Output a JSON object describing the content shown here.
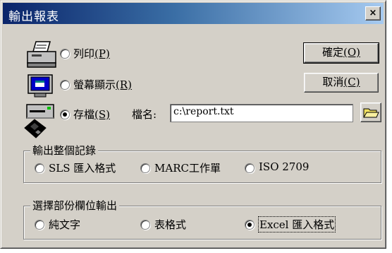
{
  "window": {
    "title": "輸出報表",
    "close_glyph": "×"
  },
  "output_target": {
    "print_label": "列印",
    "print_key": "(P)",
    "screen_label": "螢幕顯示",
    "screen_key": "(R)",
    "save_label": "存檔",
    "save_key": "(S)",
    "selected": "save"
  },
  "file": {
    "name_label": "檔名:",
    "value": "c:\\report.txt"
  },
  "buttons": {
    "ok_label": "確定",
    "ok_key": "(O)",
    "cancel_label": "取消",
    "cancel_key": "(C)"
  },
  "whole_record": {
    "title": "輸出整個記錄",
    "options": [
      "SLS 匯入格式",
      "MARC工作單",
      "ISO 2709"
    ]
  },
  "partial_fields": {
    "title": "選擇部份欄位輸出",
    "options": [
      "純文字",
      "表格式",
      "Excel 匯入格式"
    ],
    "selected_index": 2
  },
  "icons": [
    "printer-icon",
    "monitor-icon",
    "disk-drive-icon",
    "floppy-icon",
    "folder-icon"
  ],
  "colors": {
    "title_bar_start": "#0a246a",
    "title_bar_end": "#a6caf0",
    "face": "#d4d0c8"
  }
}
